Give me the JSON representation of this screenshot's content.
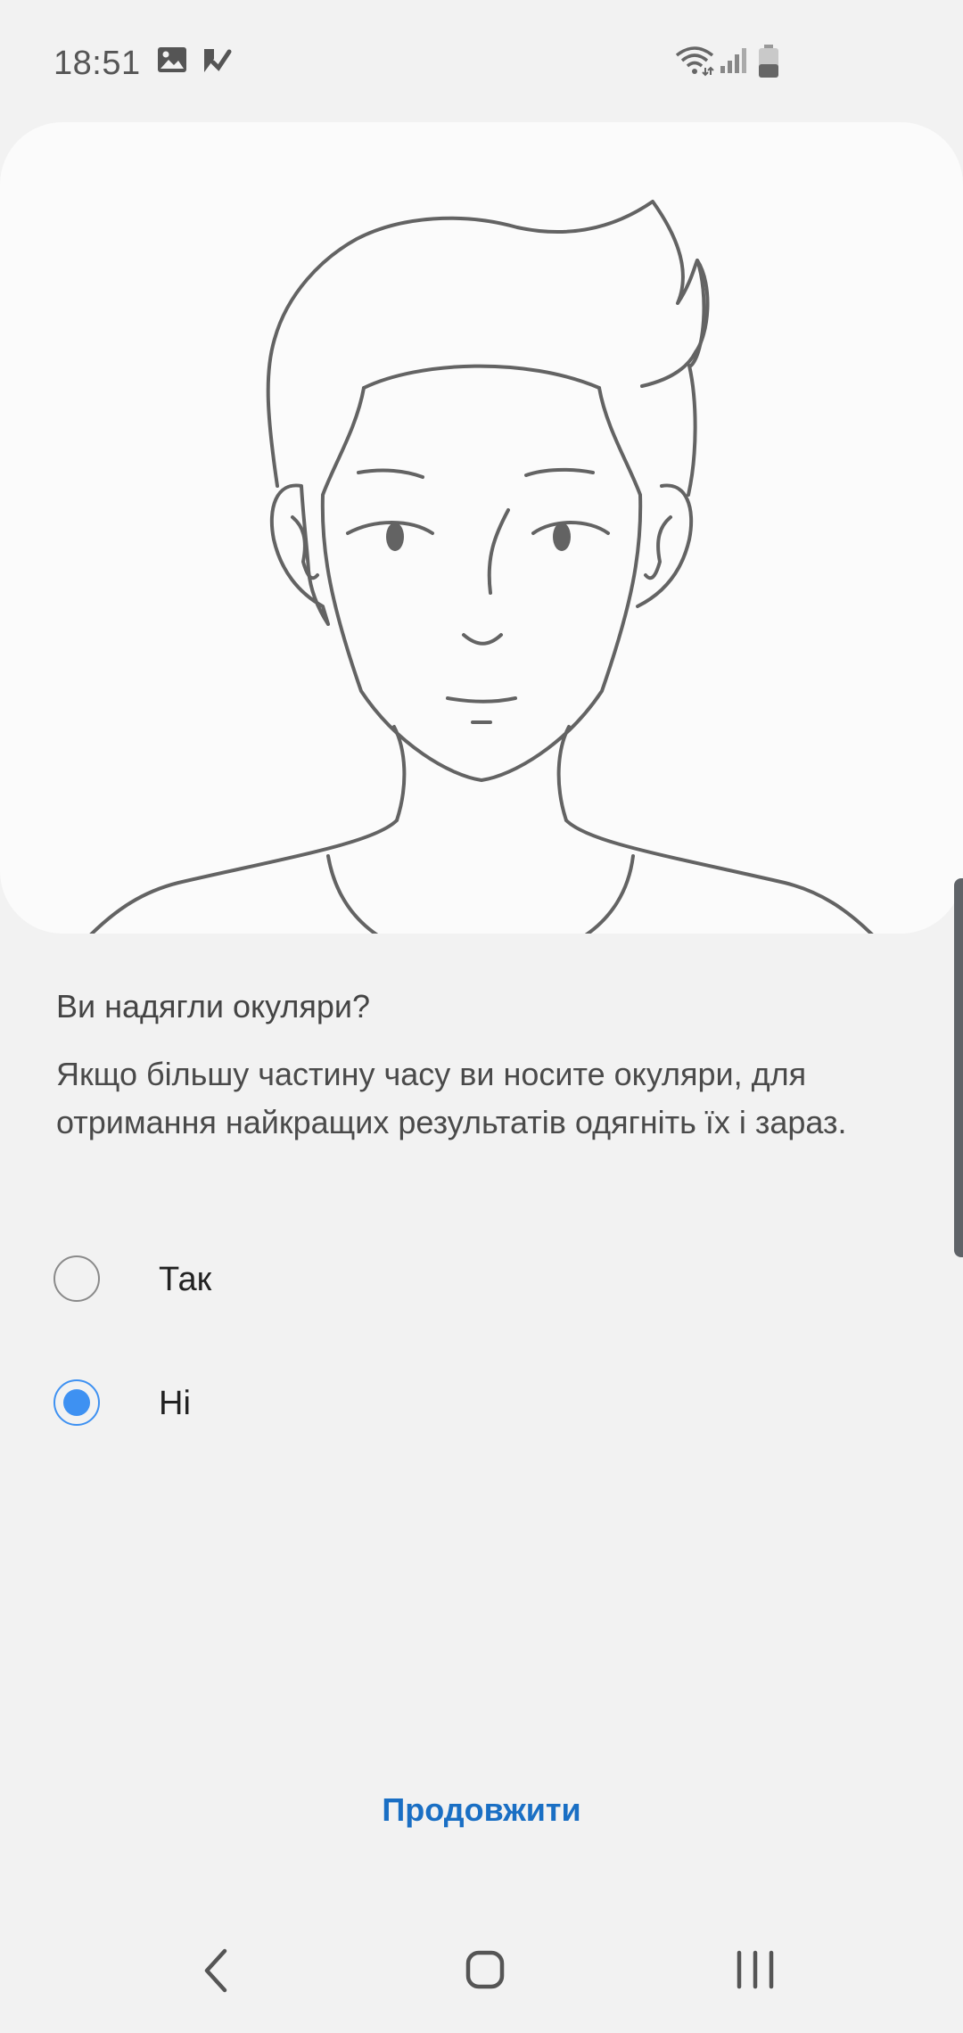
{
  "status_bar": {
    "time": "18:51",
    "icons": [
      "image-icon",
      "checklist-icon",
      "wifi-icon",
      "signal-icon",
      "battery-icon"
    ]
  },
  "illustration": {
    "icon": "face-outline-illustration"
  },
  "content": {
    "question": "Ви надягли окуляри?",
    "description": "Якщо більшу частину часу ви носите окуляри, для отримання найкращих результатів одягніть їх і зараз."
  },
  "options": [
    {
      "label": "Так",
      "selected": false
    },
    {
      "label": "Ні",
      "selected": true
    }
  ],
  "actions": {
    "continue_label": "Продовжити"
  },
  "nav_bar": {
    "icons": [
      "back-icon",
      "home-icon",
      "recents-icon"
    ]
  },
  "colors": {
    "background": "#f2f2f2",
    "card": "#fbfbfb",
    "accent": "#3e91f2",
    "link": "#1a6fc4",
    "line_art": "#636363"
  }
}
